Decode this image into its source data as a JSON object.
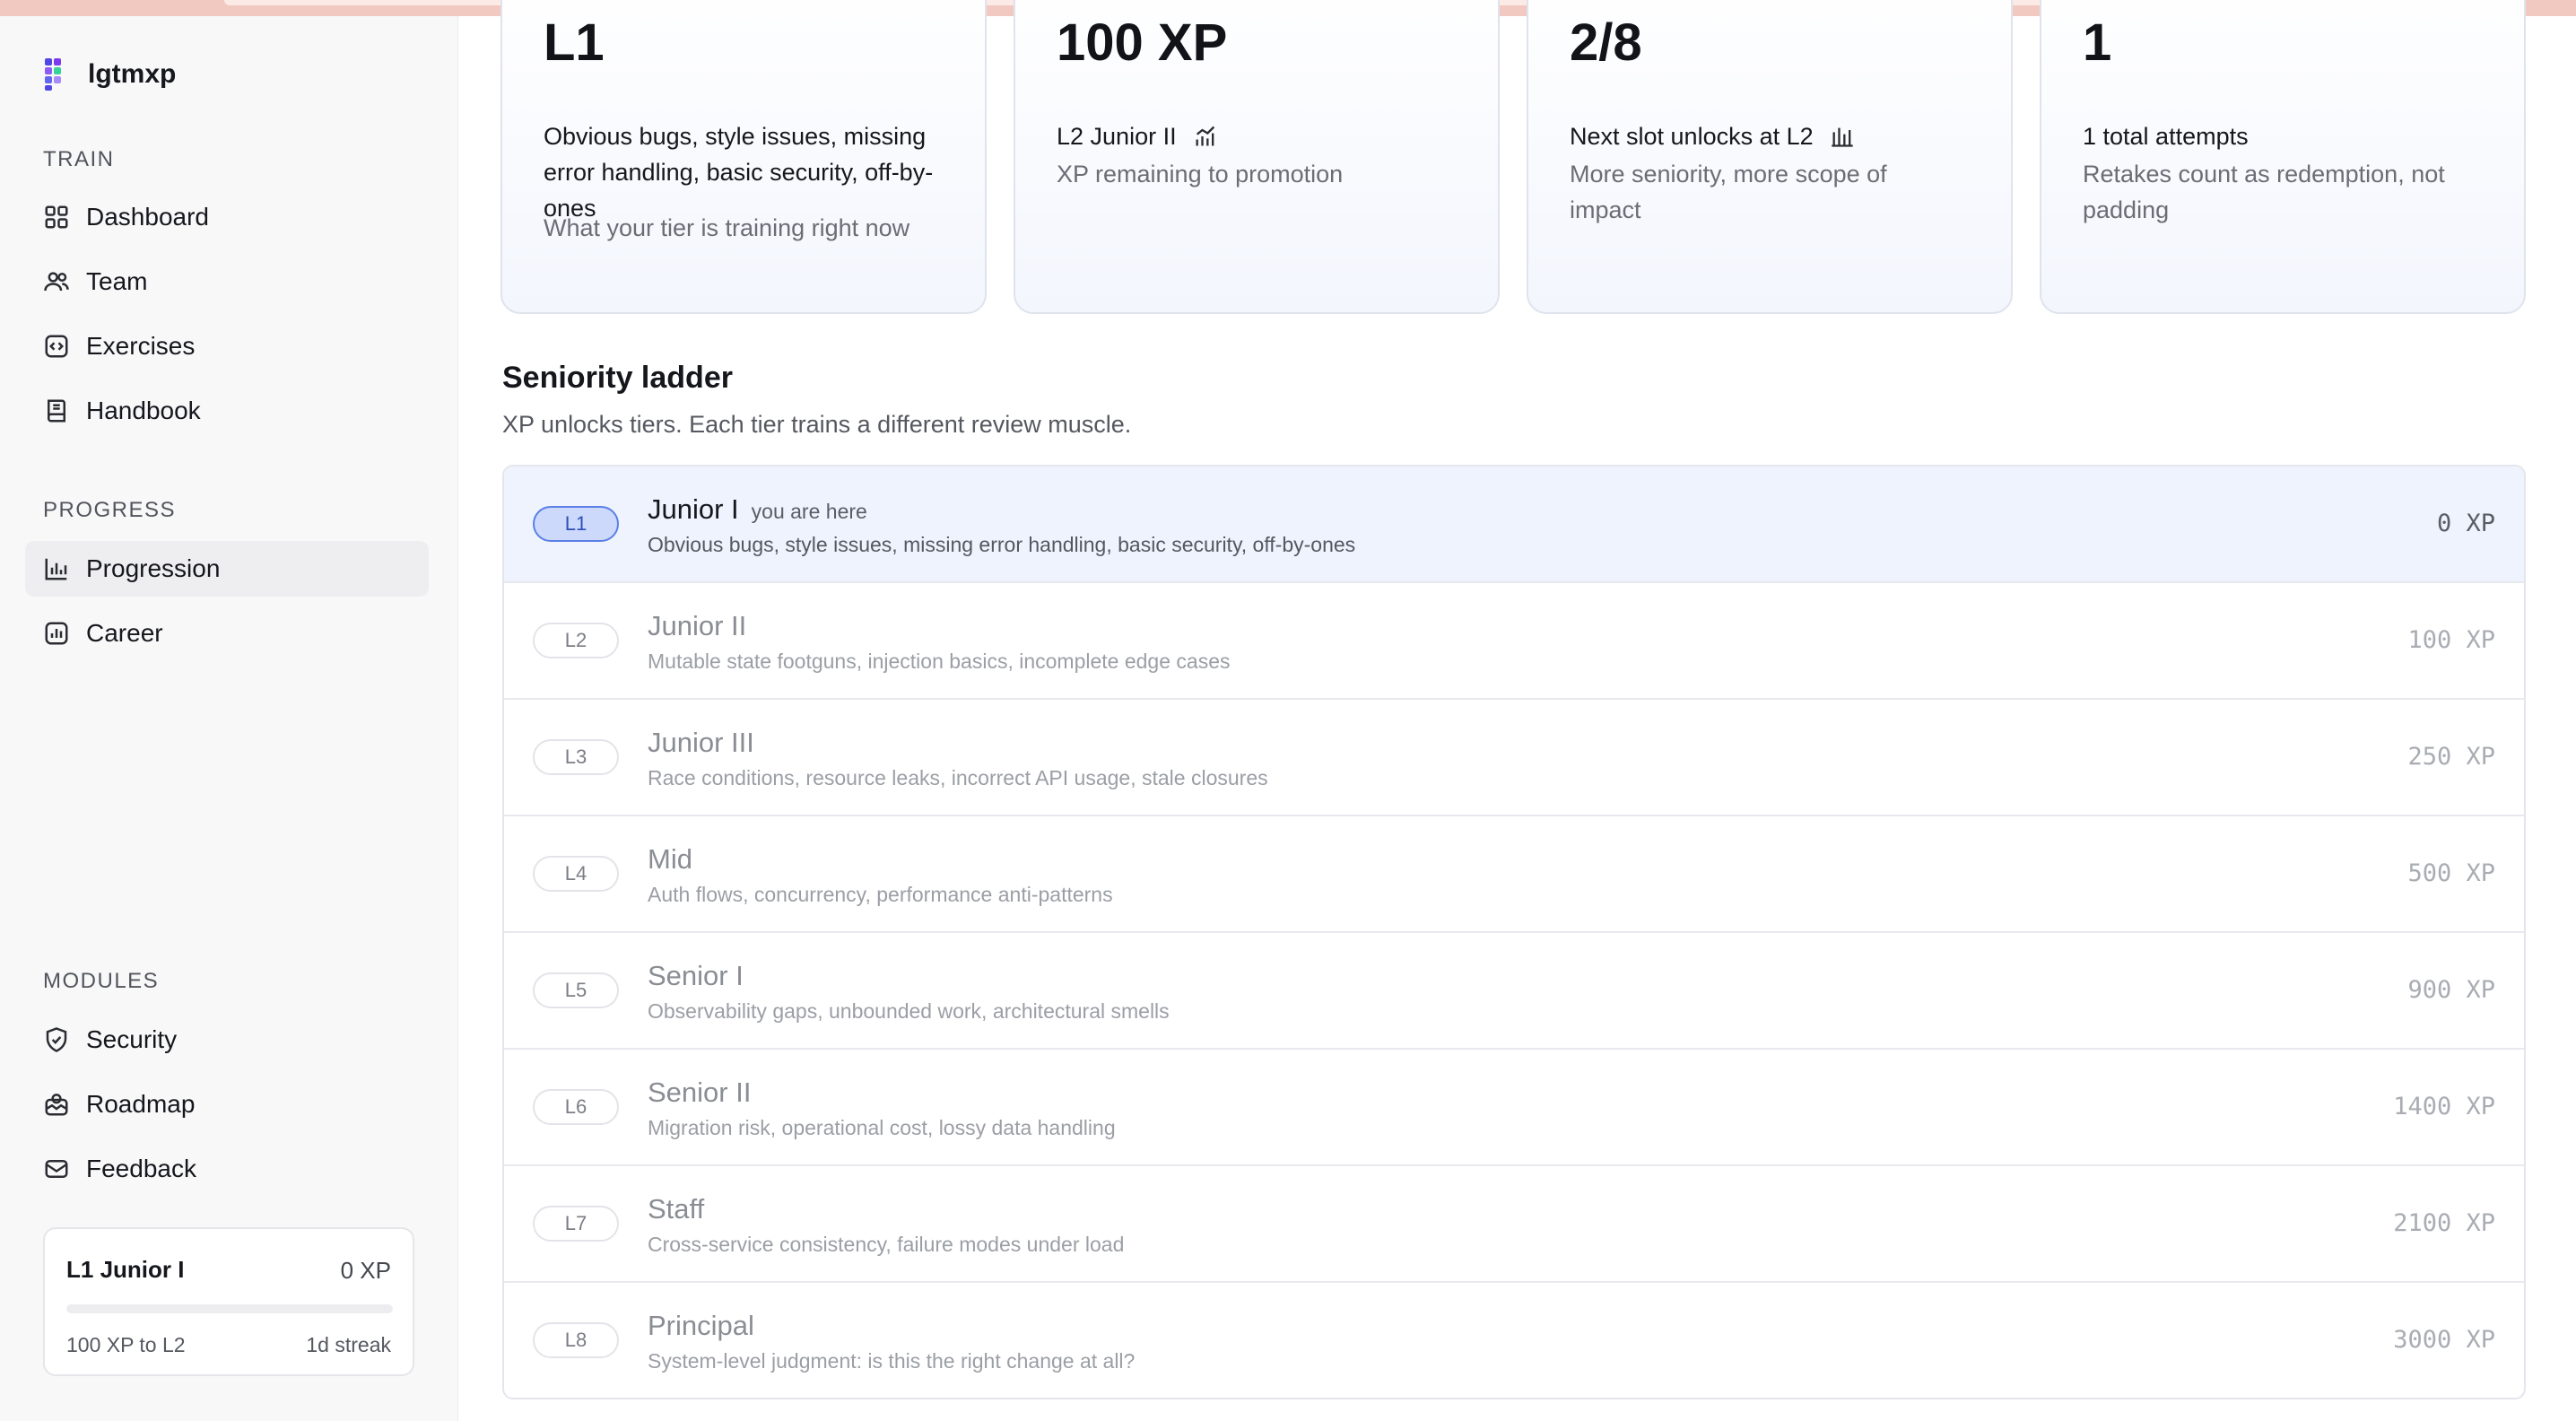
{
  "brand": {
    "name": "lgtmxp"
  },
  "sidebar": {
    "sections": {
      "train": "TRAIN",
      "progress": "PROGRESS",
      "modules": "MODULES"
    },
    "train_items": [
      {
        "label": "Dashboard",
        "icon": "grid-icon"
      },
      {
        "label": "Team",
        "icon": "users-icon"
      },
      {
        "label": "Exercises",
        "icon": "code-icon"
      },
      {
        "label": "Handbook",
        "icon": "book-icon"
      }
    ],
    "progress_items": [
      {
        "label": "Progression",
        "icon": "bar-chart-icon",
        "active": true
      },
      {
        "label": "Career",
        "icon": "chart-box-icon"
      }
    ],
    "module_items": [
      {
        "label": "Security",
        "icon": "shield-check-icon"
      },
      {
        "label": "Roadmap",
        "icon": "map-icon"
      },
      {
        "label": "Feedback",
        "icon": "mail-icon"
      }
    ],
    "status_card": {
      "tier": "L1 Junior I",
      "xp": "0 XP",
      "progress": 0,
      "to_next": "100 XP to L2",
      "streak": "1d streak"
    }
  },
  "stats": [
    {
      "value": "L1",
      "title": "Obvious bugs, style issues, missing error handling, basic security, off-by-ones",
      "sub": "What your tier is training right now"
    },
    {
      "value": "100 XP",
      "title": "L2 Junior II",
      "icon": "trend-chart-icon",
      "sub": "XP remaining to promotion"
    },
    {
      "value": "2/8",
      "title": "Next slot unlocks at L2",
      "icon": "bars-chart-icon",
      "sub": "More seniority, more scope of impact"
    },
    {
      "value": "1",
      "title": "1 total attempts",
      "sub": "Retakes count as redemption, not padding"
    }
  ],
  "ladder": {
    "heading": "Seniority ladder",
    "subheading": "XP unlocks tiers. Each tier trains a different review muscle.",
    "here_label": "you are here",
    "rungs": [
      {
        "level": "L1",
        "name": "Junior I",
        "desc": "Obvious bugs, style issues, missing error handling, basic security, off-by-ones",
        "xp": "0 XP",
        "current": true
      },
      {
        "level": "L2",
        "name": "Junior II",
        "desc": "Mutable state footguns, injection basics, incomplete edge cases",
        "xp": "100 XP"
      },
      {
        "level": "L3",
        "name": "Junior III",
        "desc": "Race conditions, resource leaks, incorrect API usage, stale closures",
        "xp": "250 XP"
      },
      {
        "level": "L4",
        "name": "Mid",
        "desc": "Auth flows, concurrency, performance anti-patterns",
        "xp": "500 XP"
      },
      {
        "level": "L5",
        "name": "Senior I",
        "desc": "Observability gaps, unbounded work, architectural smells",
        "xp": "900 XP"
      },
      {
        "level": "L6",
        "name": "Senior II",
        "desc": "Migration risk, operational cost, lossy data handling",
        "xp": "1400 XP"
      },
      {
        "level": "L7",
        "name": "Staff",
        "desc": "Cross-service consistency, failure modes under load",
        "xp": "2100 XP"
      },
      {
        "level": "L8",
        "name": "Principal",
        "desc": "System-level judgment: is this the right change at all?",
        "xp": "3000 XP"
      }
    ]
  },
  "colors": {
    "accent": "#7a5af8",
    "current_row": "#eef3fe",
    "current_pill": "#cdd9fb"
  }
}
